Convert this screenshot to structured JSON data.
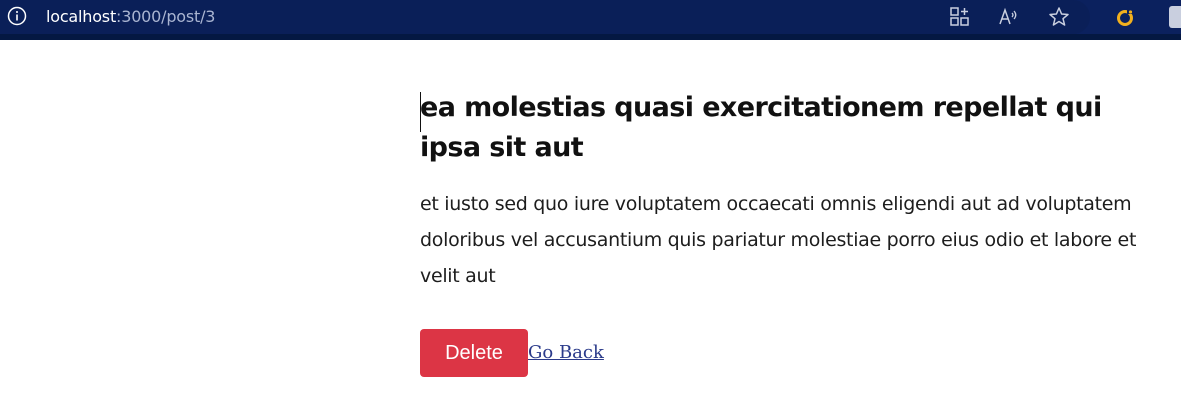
{
  "browser": {
    "url_host": "localhost",
    "url_path": ":3000/post/3",
    "icons": {
      "info": "info-icon",
      "apps": "apps-icon",
      "read_aloud": "read-aloud-icon",
      "favorites": "star-icon",
      "extension": "extension-icon",
      "profile": "profile-icon"
    },
    "colors": {
      "toolbar_bg": "#0b215e",
      "extension_accent": "#f2b01e"
    }
  },
  "post": {
    "title": "ea molestias quasi exercitationem repellat qui ipsa sit aut",
    "body": "et iusto sed quo iure voluptatem occaecati omnis eligendi aut ad voluptatem doloribus vel accusantium quis pariatur molestiae porro eius odio et labore et velit aut"
  },
  "actions": {
    "delete_label": "Delete",
    "go_back_label": "Go Back",
    "delete_color": "#dc3545"
  }
}
